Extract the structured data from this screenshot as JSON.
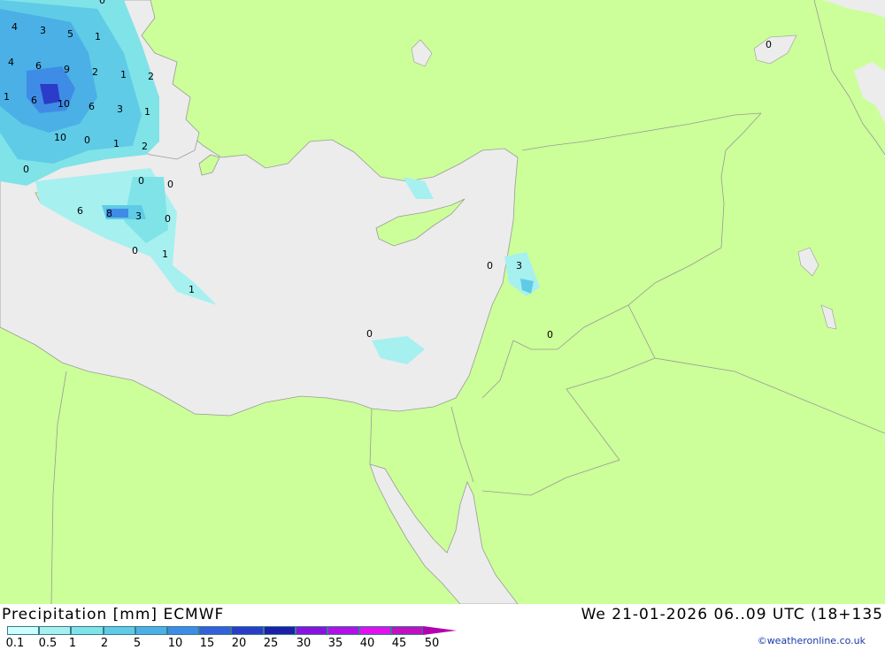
{
  "title": "Precipitation [mm] ECMWF",
  "datetime": "We 21-01-2026 06..09 UTC (18+135",
  "credit": "©weatheronline.co.uk",
  "colors": {
    "land": "#ccff99",
    "sea": "#ececec",
    "border": "#999999",
    "precip": [
      "#ccffff",
      "#a6f0f0",
      "#7fe3e8",
      "#5fcbe6",
      "#4ab0e6",
      "#3f8ce6",
      "#3460da",
      "#2a3cc8",
      "#1c20a8",
      "#8a12e0",
      "#b210e6",
      "#e010f0",
      "#c010c0",
      "#b000b0"
    ]
  },
  "legend": {
    "labels": [
      "0.1",
      "0.5",
      "1",
      "2",
      "5",
      "10",
      "15",
      "20",
      "25",
      "30",
      "35",
      "40",
      "45",
      "50"
    ]
  },
  "map_values": [
    "4",
    "3",
    "5",
    "1",
    "4",
    "6",
    "9",
    "2",
    "1",
    "2",
    "1",
    "6",
    "10",
    "6",
    "3",
    "1",
    "10",
    "0",
    "1",
    "2",
    "0",
    "0",
    "0",
    "6",
    "8",
    "3",
    "0",
    "0",
    "1",
    "1",
    "0",
    "3",
    "0",
    "0",
    "0",
    "0"
  ]
}
